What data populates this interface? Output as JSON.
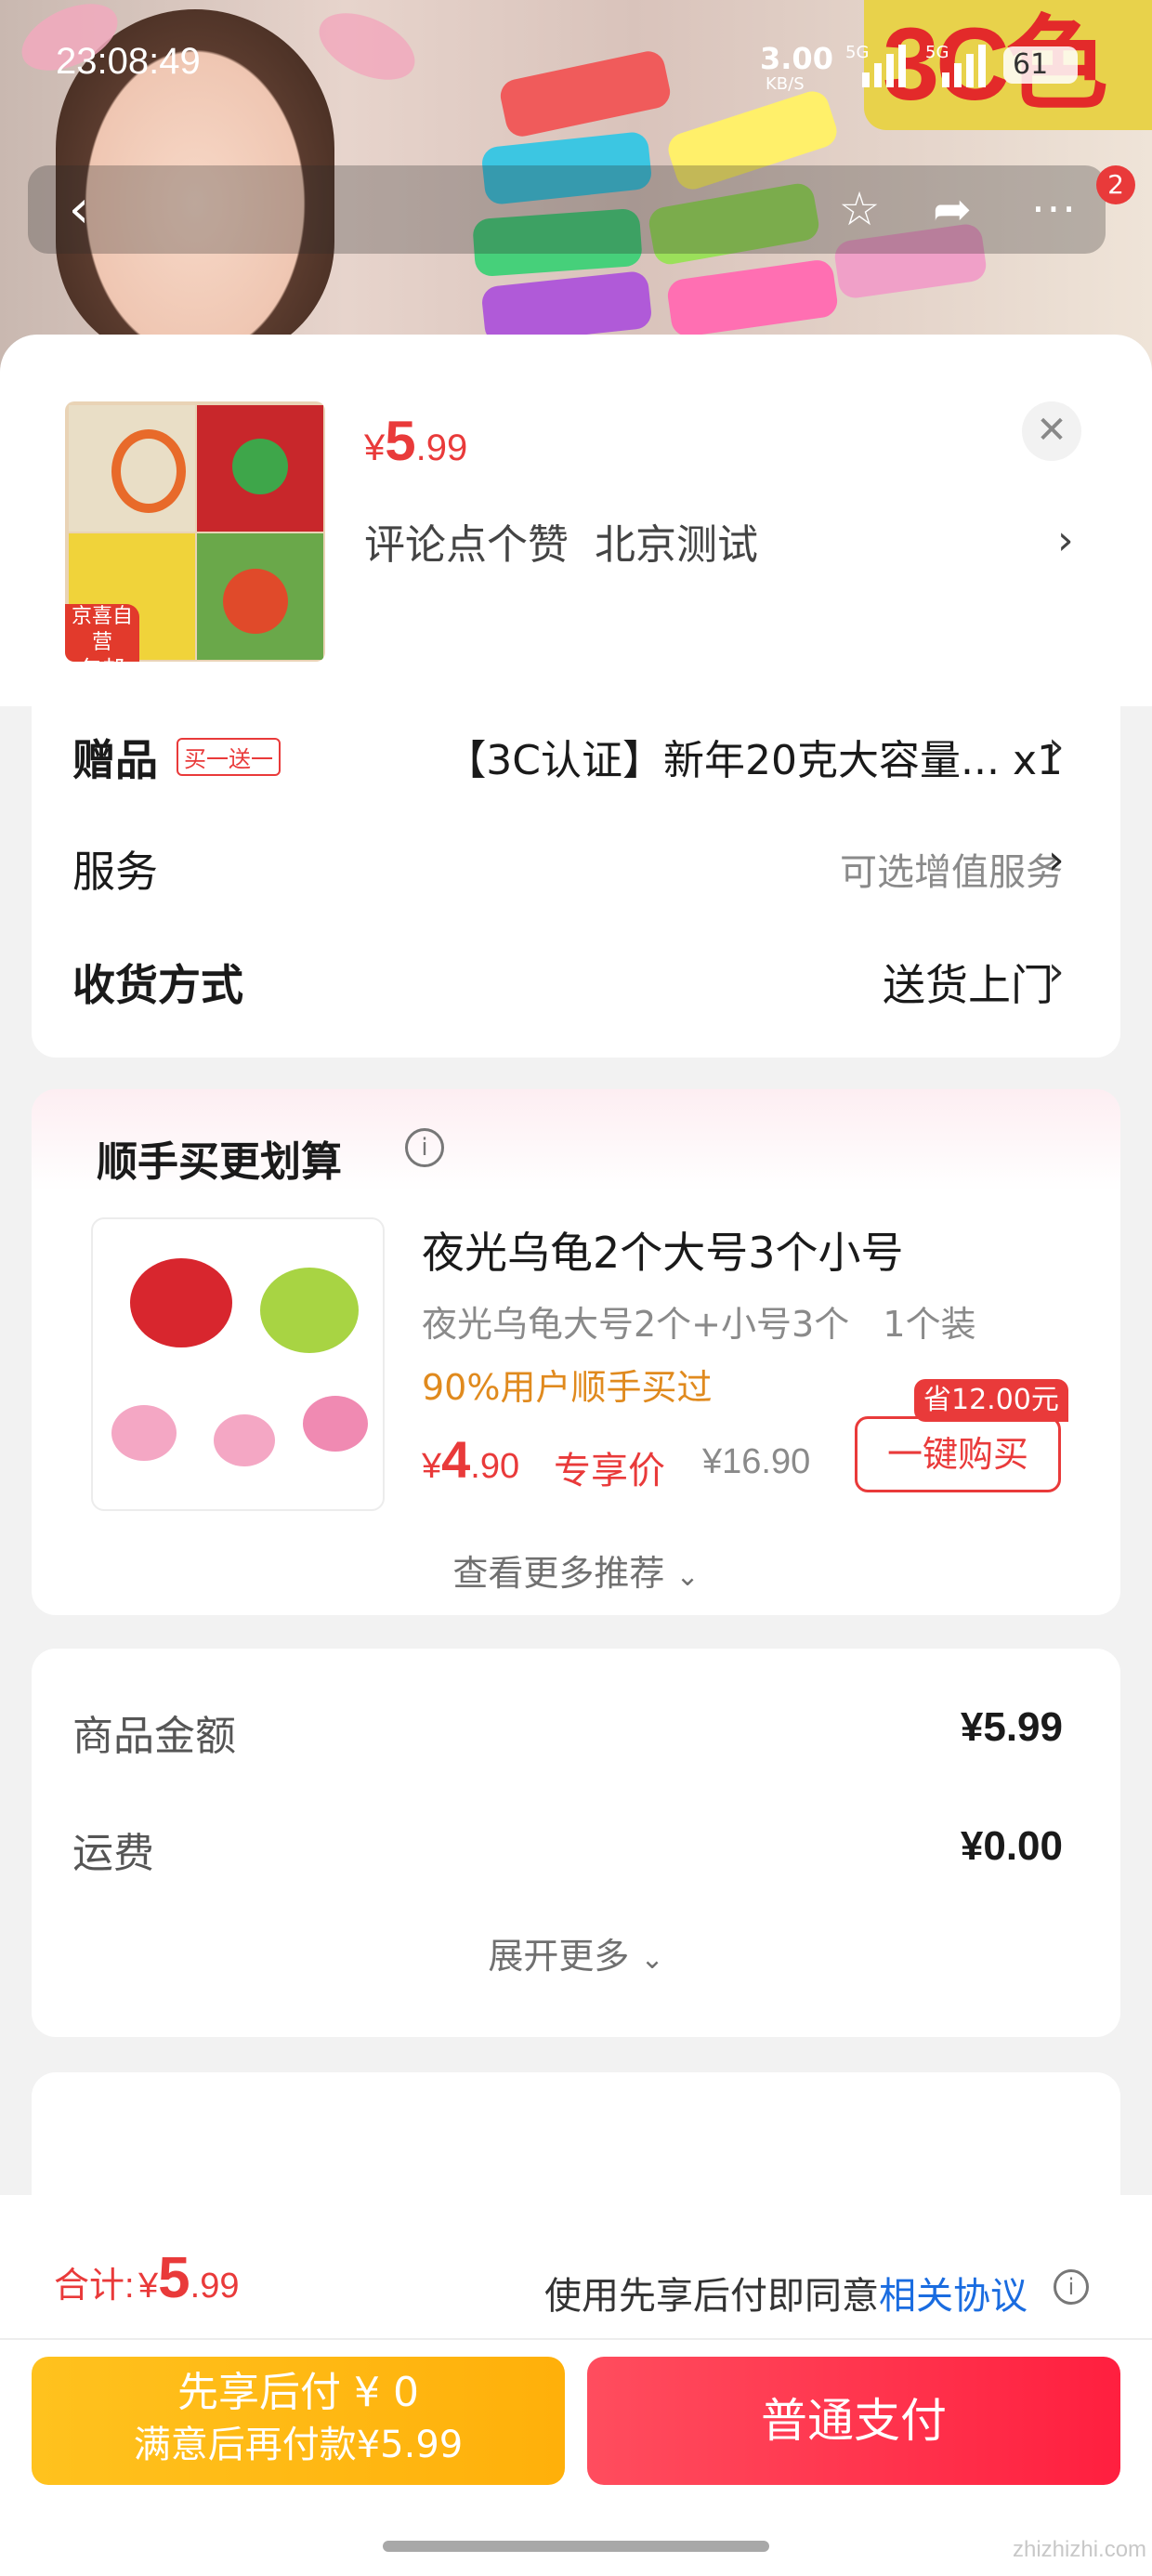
{
  "status_bar": {
    "time": "23:08:49",
    "network_speed": "3.00",
    "network_unit": "KB/S",
    "sim1": "5G",
    "sim2": "5G",
    "battery": "61"
  },
  "hero": {
    "tag_text": "3C色"
  },
  "nav": {
    "back_icon": "chevron-left-icon",
    "favorite_icon": "star-icon",
    "share_icon": "share-icon",
    "more_icon": "more-icon",
    "badge_count": "2"
  },
  "product": {
    "price_symbol": "¥",
    "price_int": "5",
    "price_dec": ".99",
    "spec": "评论点个赞  北京测试",
    "thumb_badge_line1": "京喜自营",
    "thumb_badge_line2": "包邮"
  },
  "rows": {
    "gift_label": "赠品",
    "gift_tag": "买一送一",
    "gift_value": "【3C认证】新年20克大容量... x1",
    "service_label": "服务",
    "service_value": "可选增值服务",
    "delivery_label": "收货方式",
    "delivery_value": "送货上门"
  },
  "recommend": {
    "title": "顺手买更划算",
    "item_title": "夜光乌龟2个大号3个小号",
    "item_spec": "夜光乌龟大号2个+小号3个   1个装",
    "item_hint": "90%用户顺手买过",
    "price_symbol": "¥",
    "price_int": "4",
    "price_dec": ".90",
    "price_tag": "专享价",
    "original_price": "¥16.90",
    "save_badge": "省12.00元",
    "buy_button": "一键购买",
    "more_link": "查看更多推荐"
  },
  "summary": {
    "goods_label": "商品金额",
    "goods_value": "¥5.99",
    "shipping_label": "运费",
    "shipping_value": "¥0.00",
    "expand": "展开更多"
  },
  "footer": {
    "total_label": "合计:",
    "total_symbol": "¥",
    "total_int": "5",
    "total_dec": ".99",
    "agreement_prefix": "使用先享后付即同意",
    "agreement_link": "相关协议",
    "pay_later_line1": "先享后付 ¥ 0",
    "pay_later_line2": "满意后再付款¥5.99",
    "pay_normal": "普通支付"
  },
  "watermark": "zhizhizhi.com",
  "colors": {
    "accent_red": "#e93a3a",
    "link_blue": "#1a6ce0",
    "orange_hint": "#e08a1e",
    "pay_later": "#ffb80f",
    "pay_normal": "#ff2a45"
  }
}
